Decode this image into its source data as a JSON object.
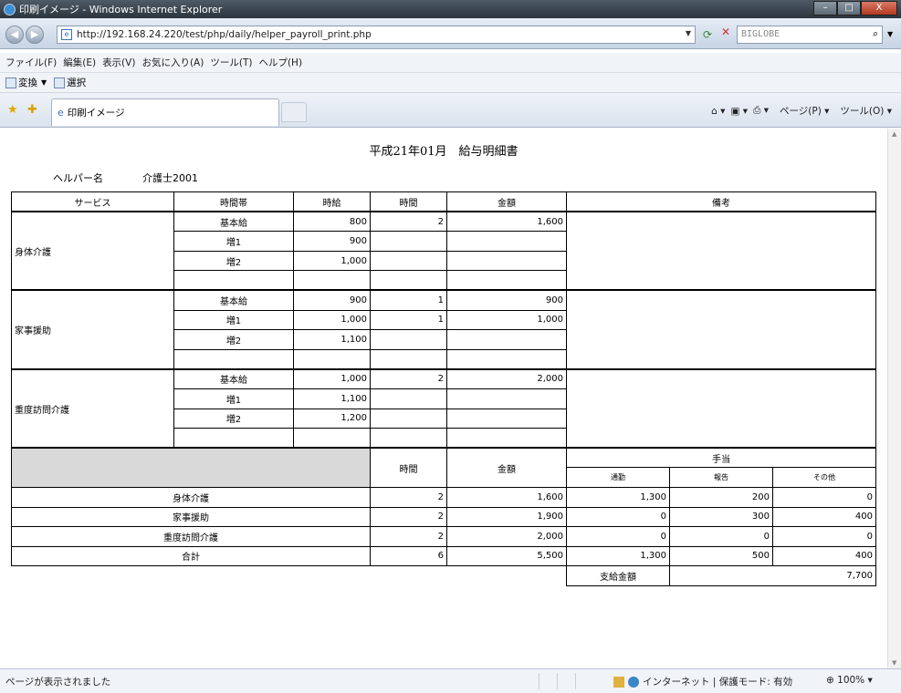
{
  "window": {
    "title": "印刷イメージ - Windows Internet Explorer",
    "controls": {
      "minimize": "–",
      "maximize": "□",
      "close": "X"
    }
  },
  "address": {
    "url": "http://192.168.24.220/test/php/daily/helper_payroll_print.php",
    "search_placeholder": "BIGLOBE"
  },
  "menu": [
    "ファイル(F)",
    "編集(E)",
    "表示(V)",
    "お気に入り(A)",
    "ツール(T)",
    "ヘルプ(H)"
  ],
  "toolbar": {
    "convert_label": "変換",
    "select_label": "選択"
  },
  "tab": {
    "label": "印刷イメージ"
  },
  "commandbar": {
    "page_label": "ページ(P)",
    "tools_label": "ツール(O)"
  },
  "document": {
    "title": "平成21年01月　給与明細書",
    "helper_label": "ヘルパー名",
    "helper_name": "介護士2001",
    "headers": {
      "service": "サービス",
      "time_band": "時間帯",
      "hourly": "時給",
      "hours": "時間",
      "amount": "金額",
      "remarks": "備考"
    },
    "sections": [
      {
        "name": "身体介護",
        "rows": [
          {
            "band": "基本給",
            "hourly": "800",
            "hours": "2",
            "amount": "1,600"
          },
          {
            "band": "増1",
            "hourly": "900",
            "hours": "",
            "amount": ""
          },
          {
            "band": "増2",
            "hourly": "1,000",
            "hours": "",
            "amount": ""
          },
          {
            "band": "",
            "hourly": "",
            "hours": "",
            "amount": ""
          }
        ]
      },
      {
        "name": "家事援助",
        "rows": [
          {
            "band": "基本給",
            "hourly": "900",
            "hours": "1",
            "amount": "900"
          },
          {
            "band": "増1",
            "hourly": "1,000",
            "hours": "1",
            "amount": "1,000"
          },
          {
            "band": "増2",
            "hourly": "1,100",
            "hours": "",
            "amount": ""
          },
          {
            "band": "",
            "hourly": "",
            "hours": "",
            "amount": ""
          }
        ]
      },
      {
        "name": "重度訪問介護",
        "rows": [
          {
            "band": "基本給",
            "hourly": "1,000",
            "hours": "2",
            "amount": "2,000"
          },
          {
            "band": "増1",
            "hourly": "1,100",
            "hours": "",
            "amount": ""
          },
          {
            "band": "増2",
            "hourly": "1,200",
            "hours": "",
            "amount": ""
          },
          {
            "band": "",
            "hourly": "",
            "hours": "",
            "amount": ""
          }
        ]
      }
    ],
    "summary_headers": {
      "hours": "時間",
      "amount": "金額",
      "allowance": "手当",
      "commute": "通勤",
      "report": "報告",
      "other": "その他"
    },
    "summary_rows": [
      {
        "label": "身体介護",
        "hours": "2",
        "amount": "1,600",
        "commute": "1,300",
        "report": "200",
        "other": "0"
      },
      {
        "label": "家事援助",
        "hours": "2",
        "amount": "1,900",
        "commute": "0",
        "report": "300",
        "other": "400"
      },
      {
        "label": "重度訪問介護",
        "hours": "2",
        "amount": "2,000",
        "commute": "0",
        "report": "0",
        "other": "0"
      },
      {
        "label": "合計",
        "hours": "6",
        "amount": "5,500",
        "commute": "1,300",
        "report": "500",
        "other": "400"
      }
    ],
    "payment_label": "支給金額",
    "payment_total": "7,700"
  },
  "status": {
    "text": "ページが表示されました",
    "zone": "インターネット | 保護モード: 有効",
    "zoom": "100%"
  }
}
